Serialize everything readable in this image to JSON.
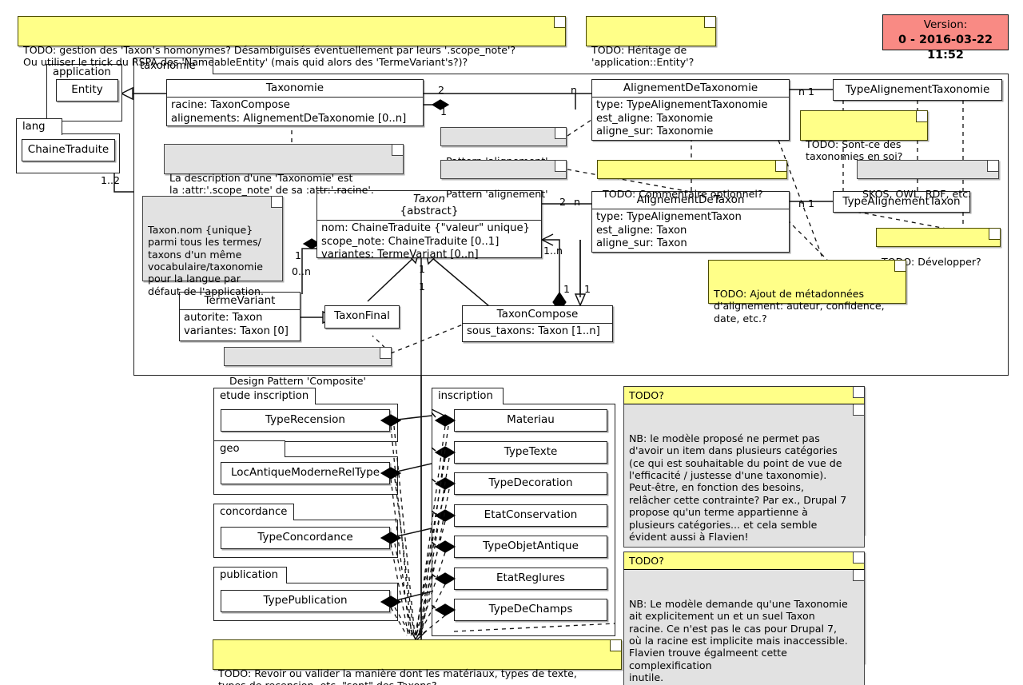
{
  "version_box": {
    "label": "Version:",
    "value": "0 - 2016-03-22 11:52"
  },
  "top_notes": [
    {
      "name": "note-homonymes",
      "text": "TODO: gestion des 'Taxon's homonymes? Désambiguisés éventuellement par leurs '.scope_note'?\nOu utiliser le trick du RSPA des 'NameableEntity' (mais quid alors des 'TermeVariant's?)?"
    },
    {
      "name": "note-heritage",
      "text": "TODO: Héritage de\n'application::Entity'?"
    }
  ],
  "packages": {
    "application": {
      "label": "application"
    },
    "lang": {
      "label": "lang"
    },
    "taxonomie": {
      "label": "taxonomie"
    },
    "etude_inscription": {
      "label": "etude inscription"
    },
    "geo": {
      "label": "geo"
    },
    "concordance": {
      "label": "concordance"
    },
    "publication": {
      "label": "publication"
    },
    "inscription": {
      "label": "inscription"
    }
  },
  "classes": {
    "entity": {
      "name": "Entity",
      "attrs": []
    },
    "chaine_traduite": {
      "name": "ChaineTraduite",
      "attrs": []
    },
    "taxonomie": {
      "name": "Taxonomie",
      "attrs": [
        "racine: TaxonCompose",
        "alignements: AlignementDeTaxonomie [0..n]"
      ]
    },
    "taxon": {
      "name": "Taxon",
      "stereotype": "{abstract}",
      "attrs": [
        "nom: ChaineTraduite {\"valeur\" unique}",
        "scope_note: ChaineTraduite [0..1]",
        "variantes: TermeVariant [0..n]"
      ]
    },
    "alignement_de_taxonomie": {
      "name": "AlignementDeTaxonomie",
      "attrs": [
        "type: TypeAlignementTaxonomie",
        "est_aligne: Taxonomie",
        "aligne_sur: Taxonomie"
      ]
    },
    "alignement_de_taxon": {
      "name": "AlignementDeTaxon",
      "attrs": [
        "type: TypeAlignementTaxon",
        "est_aligne: Taxon",
        "aligne_sur: Taxon"
      ]
    },
    "type_alignement_taxonomie": {
      "name": "TypeAlignementTaxonomie",
      "attrs": []
    },
    "type_alignement_taxon": {
      "name": "TypeAlignementTaxon",
      "attrs": []
    },
    "terme_variant": {
      "name": "TermeVariant",
      "attrs": [
        "autorite: Taxon",
        "variantes: Taxon [0]"
      ]
    },
    "taxon_final": {
      "name": "TaxonFinal",
      "attrs": []
    },
    "taxon_compose": {
      "name": "TaxonCompose",
      "attrs": [
        "sous_taxons: Taxon [1..n]"
      ]
    },
    "type_recension": {
      "name": "TypeRecension",
      "attrs": []
    },
    "loc_antique_moderne_rel_type": {
      "name": "LocAntiqueModerneRelType",
      "attrs": []
    },
    "type_concordance": {
      "name": "TypeConcordance",
      "attrs": []
    },
    "type_publication": {
      "name": "TypePublication",
      "attrs": []
    },
    "materiau": {
      "name": "Materiau",
      "attrs": []
    },
    "type_texte": {
      "name": "TypeTexte",
      "attrs": []
    },
    "type_decoration": {
      "name": "TypeDecoration",
      "attrs": []
    },
    "etat_conservation": {
      "name": "EtatConservation",
      "attrs": []
    },
    "type_objet_antique": {
      "name": "TypeObjetAntique",
      "attrs": []
    },
    "etat_reglures": {
      "name": "EtatReglures",
      "attrs": []
    },
    "type_de_champs": {
      "name": "TypeDeChamps",
      "attrs": []
    }
  },
  "notes": {
    "description_taxonomie": "La description d'une 'Taxonomie' est\nla :attr:'.scope_note' de sa :attr:'.racine'.",
    "taxon_nom_unique": "Taxon.nom {unique}\nparmi tous les termes/\ntaxons d'un même\nvocabulaire/taxonomie\npour la langue par\ndéfaut de l'application.",
    "pattern_alignement_1": "Pattern 'alignement'",
    "pattern_alignement_2": "Pattern 'alignement'",
    "commentaire_optionnel": "TODO: Commentaire optionnel?",
    "sont_ce_taxonomies": "TODO: Sont-ce des\ntaxonomies en soi?",
    "skos_owl_rdf": "SKOS, OWL, RDF, etc.",
    "developper": "TODO: Développer?",
    "metadonnees": "TODO: Ajout de métadonnées\nd'alignement: auteur, confidence,\ndate, etc.?",
    "design_pattern_composite": "Design Pattern 'Composite'",
    "revoir_valider": "TODO: Revoir ou valider la manière dont les matériaux, types de texte,\ntypes de recension, etc. \"sont\" des Taxons?"
  },
  "side_notes": [
    {
      "name": "note-categories-multiples",
      "header": "TODO?",
      "body": "NB: le modèle proposé ne permet pas\nd'avoir un item dans plusieurs catégories\n(ce qui est souhaitable du point de vue de\nl'efficacité / justesse d'une taxonomie).\nPeut-être, en fonction des besoins,\nrelâcher cette contrainte? Par ex., Drupal 7\npropose qu'un terme appartienne à\nplusieurs catégories... et cela semble\névident aussi à Flavien!"
    },
    {
      "name": "note-taxon-racine",
      "header": "TODO?",
      "body": "NB: Le modèle demande qu'une Taxonomie\nait explicitement un et un suel Taxon\nracine. Ce n'est pas le cas pour Drupal 7,\noù la racine est implicite mais inaccessible.\nFlavien trouve égalmeent cette complexification\ninutile."
    }
  ],
  "multiplicities": {
    "m_1_2": "1..2",
    "m_2_a": "2",
    "m_n_a": "n",
    "m_1_a": "1",
    "m_n1_a": "n 1",
    "m_2_b": "2",
    "m_n_b": "n",
    "m_n1_b": "n 1",
    "m_1_left": "1",
    "m_0n_left": "0..n",
    "m_1_tf": "1",
    "m_1_tf2": "1",
    "m_1n": "1..n",
    "m_1_tc": "1",
    "m_1_tc2": "1"
  }
}
